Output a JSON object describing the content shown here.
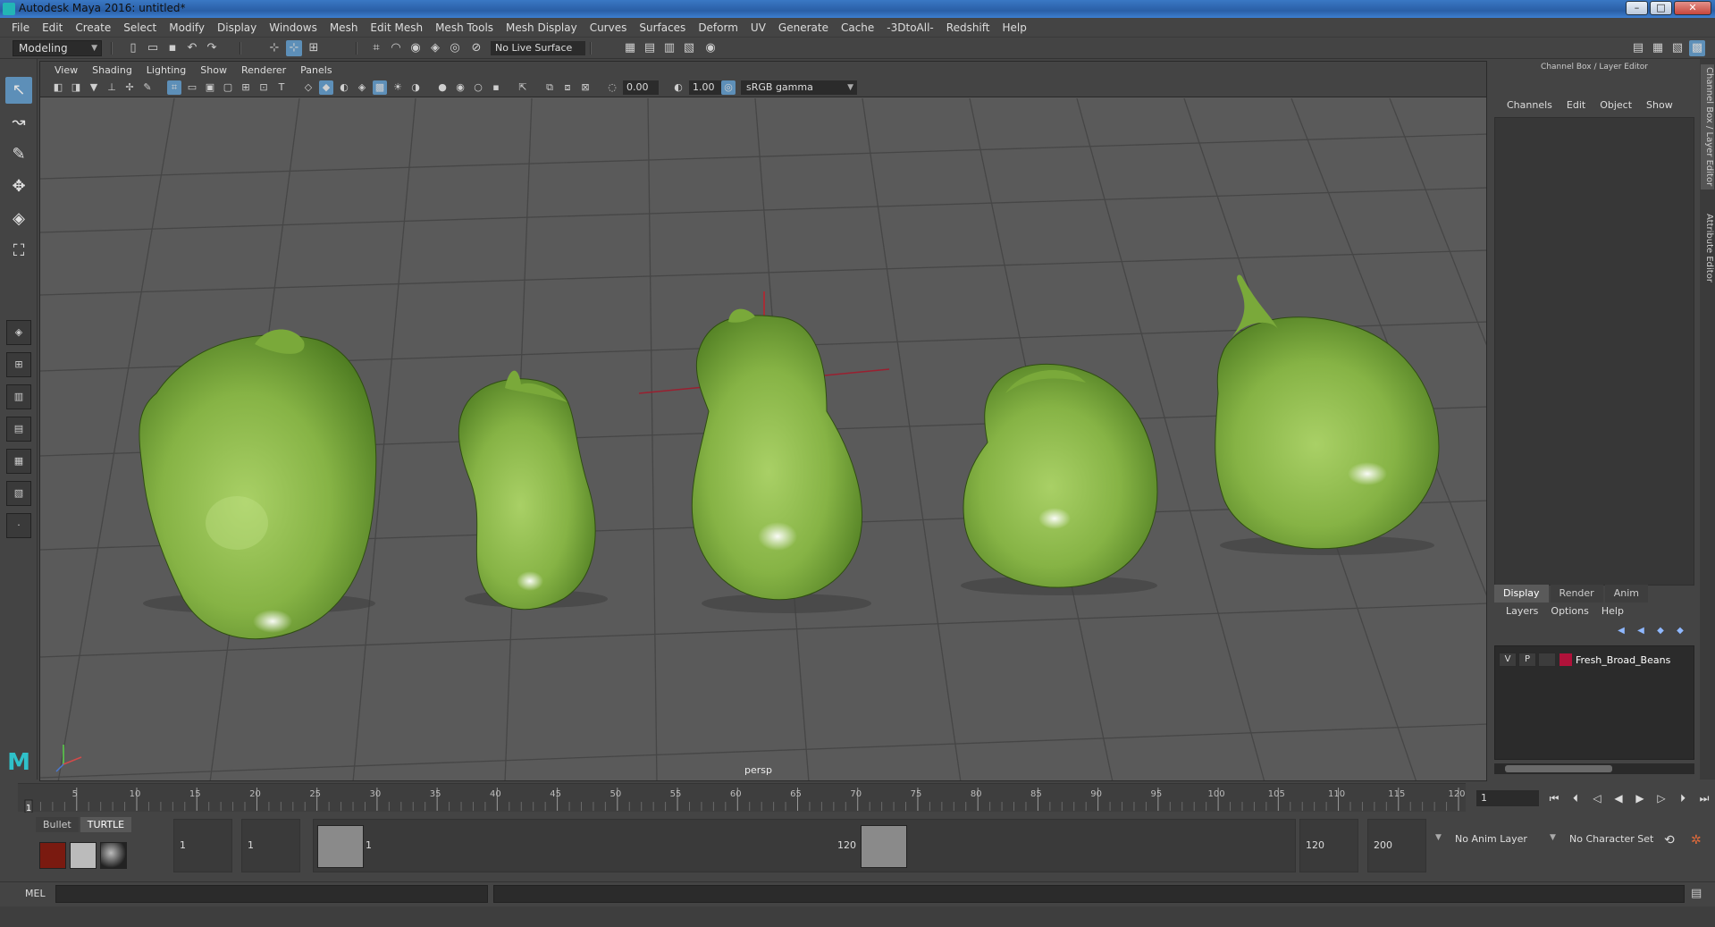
{
  "window": {
    "title": "Autodesk Maya 2016: untitled*",
    "buttons": [
      "–",
      "□",
      "✕"
    ]
  },
  "menubar": [
    "File",
    "Edit",
    "Create",
    "Select",
    "Modify",
    "Display",
    "Windows",
    "Mesh",
    "Edit Mesh",
    "Mesh Tools",
    "Mesh Display",
    "Curves",
    "Surfaces",
    "Deform",
    "UV",
    "Generate",
    "Cache",
    "-3DtoAll-",
    "Redshift",
    "Help"
  ],
  "statusline": {
    "mode": "Modeling",
    "live_surface": "No Live Surface"
  },
  "viewport": {
    "menu": [
      "View",
      "Shading",
      "Lighting",
      "Show",
      "Renderer",
      "Panels"
    ],
    "exposure": "0.00",
    "gamma_value": "1.00",
    "color_space": "sRGB gamma",
    "camera": "persp"
  },
  "right_panel": {
    "header": "Channel Box / Layer Editor",
    "menu": [
      "Channels",
      "Edit",
      "Object",
      "Show"
    ],
    "tabs": [
      "Display",
      "Render",
      "Anim"
    ],
    "active_tab": "Display",
    "layer_menu": [
      "Layers",
      "Options",
      "Help"
    ],
    "layer": {
      "v": "V",
      "p": "P",
      "name": "Fresh_Broad_Beans",
      "color": "#b0123a"
    },
    "side_tabs": [
      "Channel Box / Layer Editor",
      "Attribute Editor"
    ]
  },
  "timeslider": {
    "ticks": [
      5,
      10,
      15,
      20,
      25,
      30,
      35,
      40,
      45,
      50,
      55,
      60,
      65,
      70,
      75,
      80,
      85,
      90,
      95,
      100,
      105,
      110,
      115,
      120
    ],
    "start_marker": "1",
    "start": 1,
    "end": 120,
    "current_frame": "1"
  },
  "range": {
    "shelf_tabs": [
      "Bullet",
      "TURTLE"
    ],
    "start_field": "1",
    "playback_start": "1",
    "range_start_label": "1",
    "range_end_label": "120",
    "playback_end": "120",
    "end_field": "200",
    "anim_layer": "No Anim Layer",
    "character_set": "No Character Set"
  },
  "cmdline": {
    "label": "MEL"
  },
  "colors": {
    "accent": "#5d8fb8",
    "bean_light": "#9cc55a",
    "bean_dark": "#4f7a24",
    "viewport_bg": "#5a5a5a"
  }
}
